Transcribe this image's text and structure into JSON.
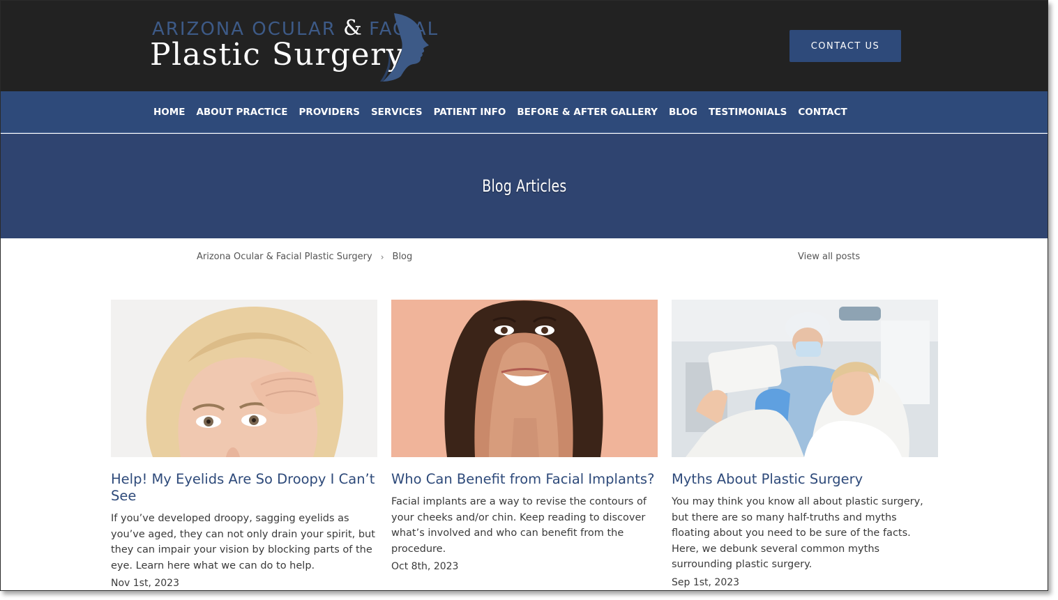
{
  "header": {
    "logo": {
      "line1_part1": "ARIZONA OCULAR",
      "amp": "&",
      "line1_part2": "FACIAL",
      "line2": "Plastic Surgery"
    },
    "contact_button": "CONTACT US"
  },
  "nav": {
    "items": [
      {
        "label": "HOME"
      },
      {
        "label": "ABOUT PRACTICE"
      },
      {
        "label": "PROVIDERS"
      },
      {
        "label": "SERVICES"
      },
      {
        "label": "PATIENT INFO"
      },
      {
        "label": "BEFORE & AFTER GALLERY"
      },
      {
        "label": "BLOG"
      },
      {
        "label": "TESTIMONIALS"
      },
      {
        "label": "CONTACT"
      }
    ]
  },
  "hero": {
    "title": "Blog Articles"
  },
  "breadcrumb": {
    "home": "Arizona Ocular & Facial Plastic Surgery",
    "separator": "›",
    "current": "Blog"
  },
  "view_all": "View all posts",
  "posts": [
    {
      "title": "Help! My Eyelids Are So Droopy I Can’t See",
      "excerpt": "If you’ve developed droopy, sagging eyelids as you’ve aged, they can not only drain your spirit, but they can impair your vision by blocking parts of the eye. Learn here what we can do to help.",
      "date": "Nov 1st, 2023"
    },
    {
      "title": "Who Can Benefit from Facial Implants?",
      "excerpt": "Facial implants are a way to revise the contours of your cheeks and/or chin. Keep reading to discover what’s involved and who can benefit from the procedure.",
      "date": "Oct 8th, 2023"
    },
    {
      "title": "Myths About Plastic Surgery",
      "excerpt": "You may think you know all about plastic surgery, but there are so many half-truths and myths floating about you need to be sure of the facts. Here, we debunk several common myths surrounding plastic surgery.",
      "date": "Sep 1st, 2023"
    }
  ],
  "colors": {
    "header_bg": "#222222",
    "nav_bg": "#2e4a7a",
    "hero_bg": "#2f4470",
    "accent": "#2e4a7a",
    "logo_blue": "#3d5a87"
  }
}
